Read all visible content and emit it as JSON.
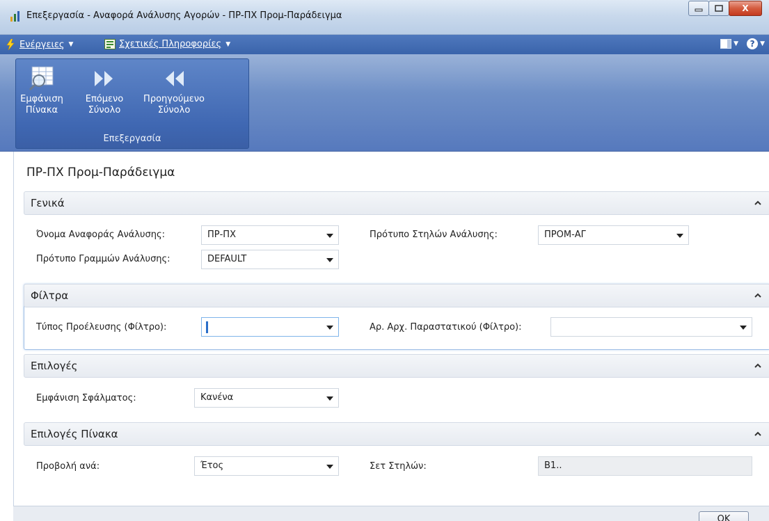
{
  "window": {
    "title": "Επεξεργασία - Αναφορά Ανάλυσης Αγορών - ΠΡ-ΠΧ Προμ-Παράδειγμα",
    "minimize_glyph": "▭",
    "maximize_glyph": "□",
    "close_glyph": "X"
  },
  "commandbar": {
    "actions_label": "Ενέργειες",
    "related_info_label": "Σχετικές Πληροφορίες",
    "help_glyph": "?"
  },
  "ribbon": {
    "group_name": "Επεξεργασία",
    "buttons": [
      {
        "line1": "Εμφάνιση",
        "line2": "Πίνακα",
        "icon": "show-matrix-icon"
      },
      {
        "line1": "Επόμενο",
        "line2": "Σύνολο",
        "icon": "next-set-icon"
      },
      {
        "line1": "Προηγούμενο",
        "line2": "Σύνολο",
        "icon": "previous-set-icon"
      }
    ]
  },
  "page": {
    "title": "ΠΡ-ΠΧ Προμ-Παράδειγμα"
  },
  "sections": {
    "general": {
      "title": "Γενικά",
      "analysis_view_label": "Όνομα Αναφοράς Ανάλυσης:",
      "analysis_view_value": "ΠΡ-ΠΧ",
      "line_template_label": "Πρότυπο Γραμμών Ανάλυσης:",
      "line_template_value": "DEFAULT",
      "column_template_label": "Πρότυπο Στηλών Ανάλυσης:",
      "column_template_value": "ΠΡΟΜ-ΑΓ"
    },
    "filters": {
      "title": "Φίλτρα",
      "source_type_label": "Τύπος Προέλευσης (Φίλτρο):",
      "source_type_value": "",
      "doc_no_label": "Αρ. Αρχ. Παραστατικού (Φίλτρο):",
      "doc_no_value": ""
    },
    "options": {
      "title": "Επιλογές",
      "show_error_label": "Εμφάνιση Σφάλματος:",
      "show_error_value": "Κανένα"
    },
    "matrix_options": {
      "title": "Επιλογές Πίνακα",
      "view_by_label": "Προβολή ανά:",
      "view_by_value": "Έτος",
      "column_set_label": "Σετ Στηλών:",
      "column_set_value": "B1.."
    }
  },
  "footer": {
    "ok_label": "OK"
  }
}
